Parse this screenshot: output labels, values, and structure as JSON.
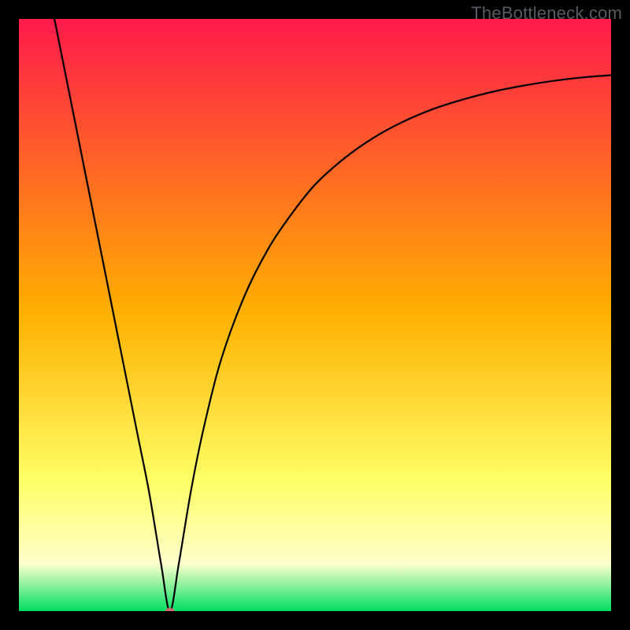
{
  "watermark": {
    "text": "TheBottleneck.com"
  },
  "chart_data": {
    "type": "line",
    "title": "",
    "xlabel": "",
    "ylabel": "",
    "xlim": [
      0,
      100
    ],
    "ylim": [
      0,
      100
    ],
    "grid": false,
    "legend": false,
    "background_gradient": {
      "stops": [
        {
          "pos": 0.0,
          "color": "#ff1a4b"
        },
        {
          "pos": 0.5,
          "color": "#ffb100"
        },
        {
          "pos": 0.78,
          "color": "#ffff66"
        },
        {
          "pos": 0.92,
          "color": "#ffffcc"
        },
        {
          "pos": 1.0,
          "color": "#00e060"
        }
      ]
    },
    "marker": {
      "x": 25.5,
      "y": 0,
      "color": "#cf696d",
      "rx": 6,
      "ry": 4
    },
    "series": [
      {
        "name": "curve",
        "x": [
          6,
          8,
          10,
          12,
          14,
          16,
          18,
          20,
          22,
          24,
          25.5,
          27,
          29,
          31,
          34,
          38,
          42,
          46,
          50,
          55,
          60,
          65,
          70,
          75,
          80,
          85,
          90,
          95,
          100
        ],
        "y": [
          100,
          90,
          80,
          70,
          60,
          50,
          40,
          30,
          20,
          8,
          0,
          8,
          20,
          30,
          42,
          53,
          61,
          67,
          72,
          76.5,
          80,
          82.7,
          84.8,
          86.4,
          87.7,
          88.7,
          89.5,
          90.1,
          90.5
        ]
      }
    ]
  }
}
